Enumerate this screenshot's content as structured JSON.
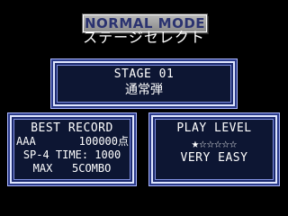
{
  "mode_title": "NORMAL MODE",
  "screen_title": "ステージセレクト",
  "stage": {
    "number_label": "STAGE 01",
    "name": "通常弾"
  },
  "best_record": {
    "title": "BEST RECORD",
    "player_name": "AAA",
    "score": "100000点",
    "time_line": "SP-4 TIME: 1000",
    "combo_line": "MAX   5COMBO"
  },
  "play_level": {
    "title": "PLAY LEVEL",
    "stars_filled": 1,
    "stars_total": 6,
    "difficulty": "VERY EASY"
  },
  "colors": {
    "banner_text": "#2a3270",
    "panel_border": "#dfe6ff",
    "panel_fill": "#0d1633"
  }
}
